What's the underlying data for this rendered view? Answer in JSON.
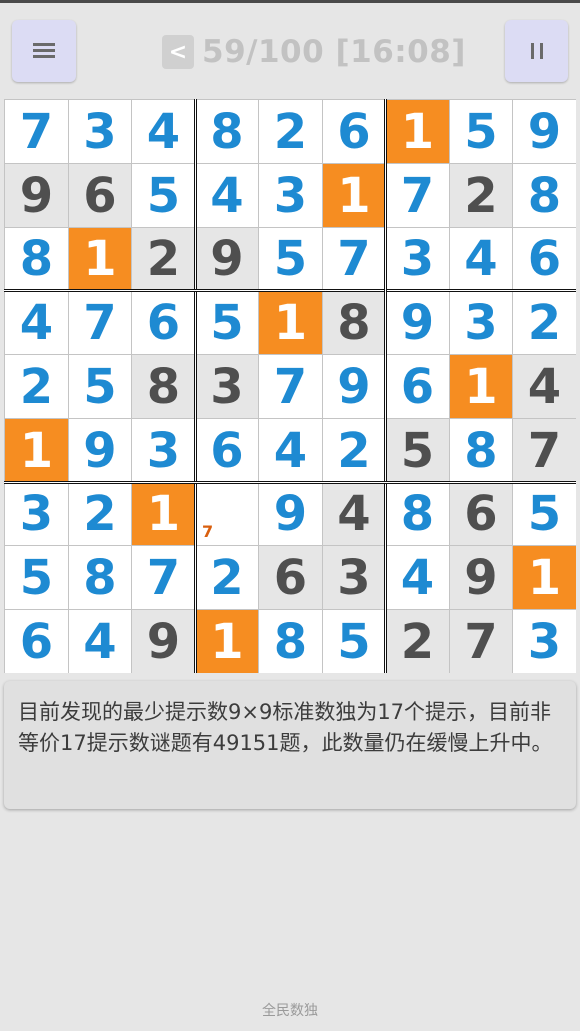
{
  "header": {
    "menu_icon": "hamburger-icon",
    "back_label": "<",
    "status": "59/100 [16:08]",
    "pause_icon": "pause-icon"
  },
  "colors": {
    "given": "#1e8ad2",
    "user": "#4f4f4f",
    "highlight": "#f68d21",
    "note": "#d95f0e"
  },
  "board": {
    "rows": [
      [
        {
          "v": "7",
          "t": "given"
        },
        {
          "v": "3",
          "t": "given"
        },
        {
          "v": "4",
          "t": "given"
        },
        {
          "v": "8",
          "t": "given"
        },
        {
          "v": "2",
          "t": "given"
        },
        {
          "v": "6",
          "t": "given"
        },
        {
          "v": "1",
          "t": "hl"
        },
        {
          "v": "5",
          "t": "given"
        },
        {
          "v": "9",
          "t": "given"
        }
      ],
      [
        {
          "v": "9",
          "t": "user"
        },
        {
          "v": "6",
          "t": "user"
        },
        {
          "v": "5",
          "t": "given"
        },
        {
          "v": "4",
          "t": "given"
        },
        {
          "v": "3",
          "t": "given"
        },
        {
          "v": "1",
          "t": "hl"
        },
        {
          "v": "7",
          "t": "given"
        },
        {
          "v": "2",
          "t": "user"
        },
        {
          "v": "8",
          "t": "given"
        }
      ],
      [
        {
          "v": "8",
          "t": "given"
        },
        {
          "v": "1",
          "t": "hl"
        },
        {
          "v": "2",
          "t": "user"
        },
        {
          "v": "9",
          "t": "user"
        },
        {
          "v": "5",
          "t": "given"
        },
        {
          "v": "7",
          "t": "given"
        },
        {
          "v": "3",
          "t": "given"
        },
        {
          "v": "4",
          "t": "given"
        },
        {
          "v": "6",
          "t": "given"
        }
      ],
      [
        {
          "v": "4",
          "t": "given"
        },
        {
          "v": "7",
          "t": "given"
        },
        {
          "v": "6",
          "t": "given"
        },
        {
          "v": "5",
          "t": "given"
        },
        {
          "v": "1",
          "t": "hl"
        },
        {
          "v": "8",
          "t": "user"
        },
        {
          "v": "9",
          "t": "given"
        },
        {
          "v": "3",
          "t": "given"
        },
        {
          "v": "2",
          "t": "given"
        }
      ],
      [
        {
          "v": "2",
          "t": "given"
        },
        {
          "v": "5",
          "t": "given"
        },
        {
          "v": "8",
          "t": "user"
        },
        {
          "v": "3",
          "t": "user"
        },
        {
          "v": "7",
          "t": "given"
        },
        {
          "v": "9",
          "t": "given"
        },
        {
          "v": "6",
          "t": "given"
        },
        {
          "v": "1",
          "t": "hl"
        },
        {
          "v": "4",
          "t": "user"
        }
      ],
      [
        {
          "v": "1",
          "t": "hl"
        },
        {
          "v": "9",
          "t": "given"
        },
        {
          "v": "3",
          "t": "given"
        },
        {
          "v": "6",
          "t": "given"
        },
        {
          "v": "4",
          "t": "given"
        },
        {
          "v": "2",
          "t": "given"
        },
        {
          "v": "5",
          "t": "user"
        },
        {
          "v": "8",
          "t": "given"
        },
        {
          "v": "7",
          "t": "user"
        }
      ],
      [
        {
          "v": "3",
          "t": "given"
        },
        {
          "v": "2",
          "t": "given"
        },
        {
          "v": "1",
          "t": "hl"
        },
        {
          "v": "",
          "t": "empty",
          "note": "7"
        },
        {
          "v": "9",
          "t": "given"
        },
        {
          "v": "4",
          "t": "user"
        },
        {
          "v": "8",
          "t": "given"
        },
        {
          "v": "6",
          "t": "user"
        },
        {
          "v": "5",
          "t": "given"
        }
      ],
      [
        {
          "v": "5",
          "t": "given"
        },
        {
          "v": "8",
          "t": "given"
        },
        {
          "v": "7",
          "t": "given"
        },
        {
          "v": "2",
          "t": "given"
        },
        {
          "v": "6",
          "t": "user"
        },
        {
          "v": "3",
          "t": "user"
        },
        {
          "v": "4",
          "t": "given"
        },
        {
          "v": "9",
          "t": "user"
        },
        {
          "v": "1",
          "t": "hl"
        }
      ],
      [
        {
          "v": "6",
          "t": "given"
        },
        {
          "v": "4",
          "t": "given"
        },
        {
          "v": "9",
          "t": "user"
        },
        {
          "v": "1",
          "t": "hl"
        },
        {
          "v": "8",
          "t": "given"
        },
        {
          "v": "5",
          "t": "given"
        },
        {
          "v": "2",
          "t": "user"
        },
        {
          "v": "7",
          "t": "user"
        },
        {
          "v": "3",
          "t": "given"
        }
      ]
    ]
  },
  "tip": {
    "text": "目前发现的最少提示数9×9标准数独为17个提示，目前非等价17提示数谜题有49151题，此数量仍在缓慢上升中。"
  },
  "footer": {
    "app_name": "全民数独"
  }
}
